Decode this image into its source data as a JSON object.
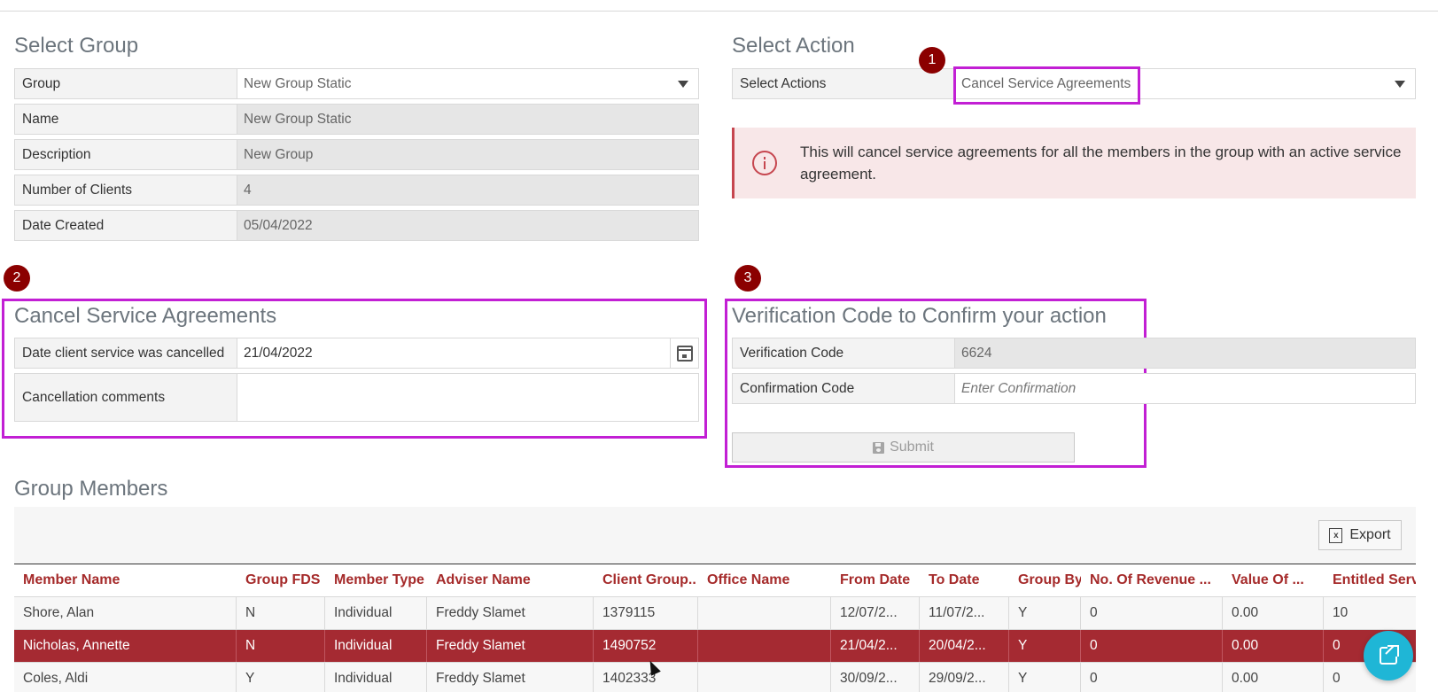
{
  "select_group": {
    "title": "Select Group",
    "group_label": "Group",
    "group_value": "New Group Static",
    "name_label": "Name",
    "name_value": "New Group Static",
    "description_label": "Description",
    "description_value": "New Group",
    "clients_label": "Number of Clients",
    "clients_value": "4",
    "date_created_label": "Date Created",
    "date_created_value": "05/04/2022"
  },
  "select_action": {
    "title": "Select Action",
    "actions_label": "Select Actions",
    "actions_value": "Cancel Service Agreements",
    "alert_text": "This will cancel service agreements for all the members in the group with an active service agreement."
  },
  "badges": [
    "1",
    "2",
    "3"
  ],
  "cancel_section": {
    "title": "Cancel Service Agreements",
    "date_label": "Date client service was cancelled",
    "date_value": "21/04/2022",
    "comments_label": "Cancellation comments",
    "comments_value": ""
  },
  "verification": {
    "title": "Verification Code to Confirm your action",
    "code_label": "Verification Code",
    "code_value": "6624",
    "confirm_label": "Confirmation Code",
    "confirm_placeholder": "Enter Confirmation",
    "submit_label": "Submit"
  },
  "group_members": {
    "title": "Group Members",
    "export_label": "Export",
    "columns": [
      "Member Name",
      "Group FDS",
      "Member Type",
      "Adviser Name",
      "Client Group..",
      "Office Name",
      "From Date",
      "To Date",
      "Group By",
      "No. Of Revenue ...",
      "Value Of ...",
      "Entitled Servic"
    ],
    "rows": [
      [
        "Shore, Alan",
        "N",
        "Individual",
        "Freddy Slamet",
        "1379115",
        "",
        "12/07/2...",
        "11/07/2...",
        "Y",
        "0",
        "0.00",
        "10"
      ],
      [
        "Nicholas, Annette",
        "N",
        "Individual",
        "Freddy Slamet",
        "1490752",
        "",
        "21/04/2...",
        "20/04/2...",
        "Y",
        "0",
        "0.00",
        "0"
      ],
      [
        "Coles, Aldi",
        "Y",
        "Individual",
        "Freddy Slamet",
        "1402333",
        "",
        "30/09/2...",
        "29/09/2...",
        "Y",
        "0",
        "0.00",
        "0"
      ]
    ],
    "selected_row": 1
  },
  "icons": {
    "dropdown": "chevron-down-icon",
    "alert": "info-circle-icon",
    "calendar": "calendar-icon",
    "submit": "save-icon",
    "export": "excel-icon",
    "fab": "share-icon"
  },
  "colors": {
    "header_text": "#a52a2a",
    "selected_row": "#a52a32",
    "highlight": "#c21fd4",
    "badge": "#8b0000",
    "fab": "#1fb6d6",
    "alert_bg": "#f8e7e8"
  }
}
